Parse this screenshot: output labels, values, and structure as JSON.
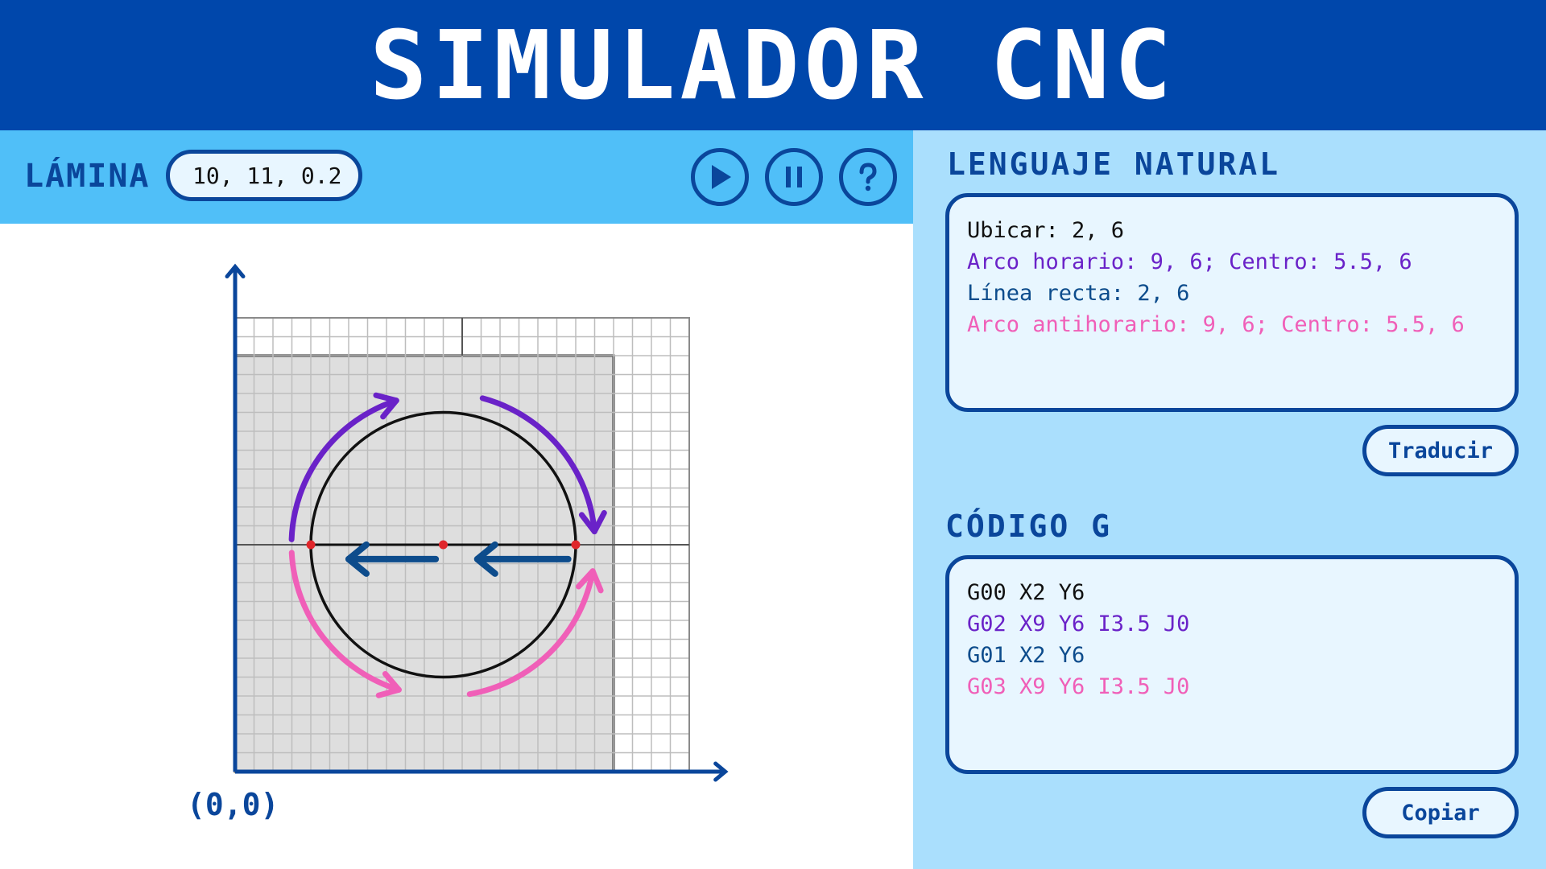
{
  "app": {
    "title": "SIMULADOR CNC"
  },
  "toolbar": {
    "lamina_label": "LÁMINA",
    "lamina_value": "10, 11, 0.2",
    "play_icon": "play-icon",
    "pause_icon": "pause-icon",
    "help_icon": "help-icon"
  },
  "canvas": {
    "origin_label": "(0,0)",
    "sheet": {
      "width": 10,
      "height": 11
    },
    "grid_extent": {
      "x": 12,
      "y": 12
    },
    "circle": {
      "center": [
        5.5,
        6
      ],
      "radius": 3.5
    },
    "points": [
      [
        2,
        6
      ],
      [
        5.5,
        6
      ],
      [
        9,
        6
      ]
    ],
    "colors": {
      "arc_cw": "#6a22c8",
      "line": "#0d4c8c",
      "arc_ccw": "#f05fb8",
      "axes": "#0a469b",
      "points": "#e0262b"
    }
  },
  "natural_language": {
    "title": "LENGUAJE NATURAL",
    "lines": [
      "Ubicar: 2, 6",
      "Arco horario: 9, 6; Centro: 5.5, 6",
      "Línea recta: 2, 6",
      "Arco antihorario: 9, 6; Centro: 5.5, 6"
    ],
    "button": "Traducir"
  },
  "gcode": {
    "title": "CÓDIGO G",
    "lines": [
      "G00 X2 Y6",
      "G02 X9 Y6 I3.5 J0",
      "G01 X2 Y6",
      "G03 X9 Y6 I3.5 J0"
    ],
    "button": "Copiar"
  }
}
